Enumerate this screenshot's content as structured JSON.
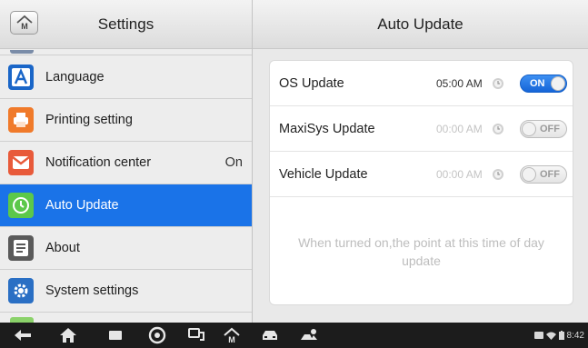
{
  "sidebar": {
    "title": "Settings",
    "home_icon_label": "M",
    "items": [
      {
        "label": "Language",
        "value": "",
        "icon": "language-icon",
        "color": "#1a66c8"
      },
      {
        "label": "Printing setting",
        "value": "",
        "icon": "printer-icon",
        "color": "#f07a2a"
      },
      {
        "label": "Notification center",
        "value": "On",
        "icon": "notification-icon",
        "color": "#e85a3a"
      },
      {
        "label": "Auto Update",
        "value": "",
        "icon": "clock-icon",
        "color": "#5cc84a",
        "active": true
      },
      {
        "label": "About",
        "value": "",
        "icon": "document-icon",
        "color": "#5a5a5a"
      },
      {
        "label": "System settings",
        "value": "",
        "icon": "gear-icon",
        "color": "#2a6fc4"
      }
    ]
  },
  "panel": {
    "title": "Auto Update",
    "rows": [
      {
        "name": "OS Update",
        "time": "05:00 AM",
        "toggle": "ON",
        "enabled": true
      },
      {
        "name": "MaxiSys Update",
        "time": "00:00 AM",
        "toggle": "OFF",
        "enabled": false
      },
      {
        "name": "Vehicle Update",
        "time": "00:00 AM",
        "toggle": "OFF",
        "enabled": false
      }
    ],
    "note": "When turned on,the point at this time of day update"
  },
  "system_bar": {
    "clock": "8:42",
    "nav_icons": [
      "back-icon",
      "home-icon",
      "recent-apps-icon",
      "browser-icon",
      "vci-icon",
      "maxisys-home-icon",
      "car-icon",
      "remote-icon"
    ]
  },
  "colors": {
    "accent": "#1a73e8",
    "header_bg": "#e6e6e6",
    "system_bar": "#1c1c1c"
  }
}
